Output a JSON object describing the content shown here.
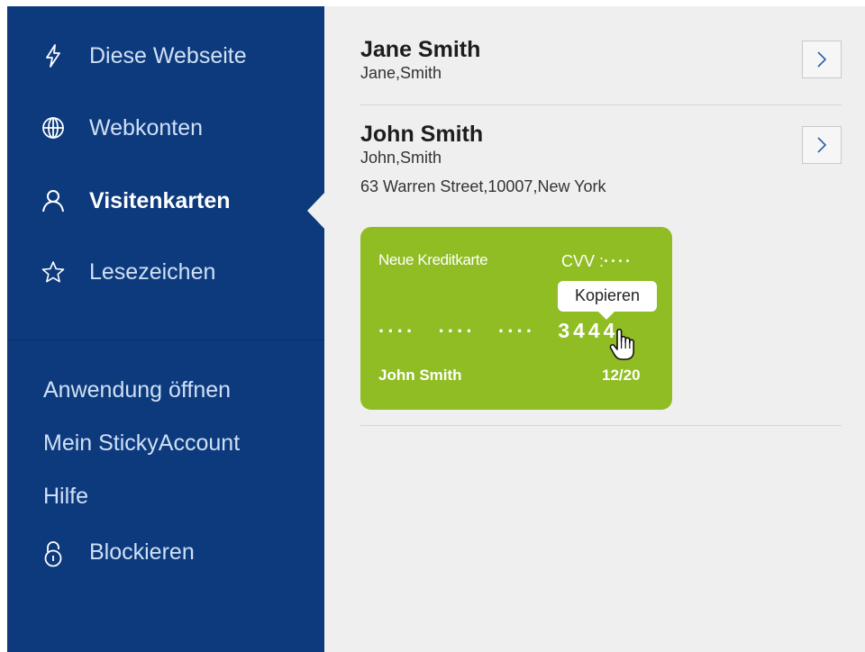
{
  "sidebar": {
    "nav": [
      {
        "label": "Diese Webseite",
        "icon": "lightning-icon"
      },
      {
        "label": "Webkonten",
        "icon": "globe-icon"
      },
      {
        "label": "Visitenkarten",
        "icon": "person-icon",
        "active": true
      },
      {
        "label": "Lesezeichen",
        "icon": "star-icon"
      }
    ],
    "links": [
      "Anwendung öffnen",
      "Mein StickyAccount",
      "Hilfe"
    ],
    "lock": {
      "label": "Blockieren",
      "icon": "lock-icon"
    }
  },
  "contacts": [
    {
      "name": "Jane Smith",
      "sub": "Jane,Smith"
    },
    {
      "name": "John Smith",
      "sub": "John,Smith",
      "address": "63 Warren Street,10007,New York"
    }
  ],
  "card": {
    "title": "Neue Kreditkarte",
    "cvv_label": "CVV :",
    "cvv_mask": "····",
    "number_masks": [
      "····",
      "····",
      "····"
    ],
    "number_last4": "3444",
    "holder": "John Smith",
    "expiry": "12/20",
    "color": "#8fbd23"
  },
  "tooltip": {
    "text": "Kopieren"
  },
  "colors": {
    "sidebar_bg": "#0d3a7d",
    "main_bg": "#efefef",
    "card_bg": "#8fbd23"
  }
}
